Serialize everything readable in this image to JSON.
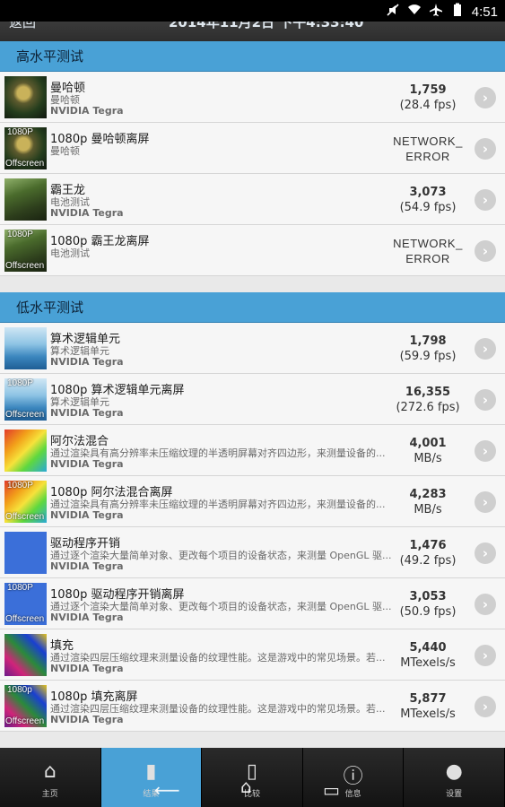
{
  "status_bar": {
    "time": "4:51"
  },
  "header": {
    "back_label": "返回",
    "date": "2014年11月2日 下午4:33:40"
  },
  "sections": [
    {
      "title": "高水平测试",
      "items": [
        {
          "thumb": "manhattan",
          "offscreen": false,
          "title": "曼哈顿",
          "desc": "曼哈顿",
          "vendor": "NVIDIA Tegra",
          "score": "1,759",
          "sub": "(28.4 fps)",
          "error": false
        },
        {
          "thumb": "manhattan",
          "offscreen": true,
          "tag_top": "1080P",
          "tag_bot": "Offscreen",
          "title": "1080p 曼哈顿离屏",
          "desc": "曼哈顿",
          "vendor": "",
          "score": "NETWORK_",
          "sub": "ERROR",
          "error": true
        },
        {
          "thumb": "trex",
          "offscreen": false,
          "title": "霸王龙",
          "desc": "电池测试",
          "vendor": "NVIDIA Tegra",
          "score": "3,073",
          "sub": "(54.9 fps)",
          "error": false
        },
        {
          "thumb": "trex",
          "offscreen": true,
          "tag_top": "1080P",
          "tag_bot": "Offscreen",
          "title": "1080p 霸王龙离屏",
          "desc": "电池测试",
          "vendor": "",
          "score": "NETWORK_",
          "sub": "ERROR",
          "error": true
        }
      ]
    },
    {
      "title": "低水平测试",
      "items": [
        {
          "thumb": "alu",
          "offscreen": false,
          "title": "算术逻辑单元",
          "desc": "算术逻辑单元",
          "vendor": "NVIDIA Tegra",
          "score": "1,798",
          "sub": "(59.9 fps)",
          "error": false
        },
        {
          "thumb": "alu",
          "offscreen": true,
          "tag_top": "1080P",
          "tag_bot": "Offscreen",
          "title": "1080p 算术逻辑单元离屏",
          "desc": "算术逻辑单元",
          "vendor": "NVIDIA Tegra",
          "score": "16,355",
          "sub": "(272.6 fps)",
          "error": false
        },
        {
          "thumb": "alpha",
          "offscreen": false,
          "title": "阿尔法混合",
          "desc": "通过渲染具有高分辨率未压缩纹理的半透明屏幕对齐四边形，来测量设备的...",
          "vendor": "NVIDIA Tegra",
          "score": "4,001",
          "sub": "MB/s",
          "error": false
        },
        {
          "thumb": "alpha",
          "offscreen": true,
          "tag_top": "1080P",
          "tag_bot": "Offscreen",
          "title": "1080p 阿尔法混合离屏",
          "desc": "通过渲染具有高分辨率未压缩纹理的半透明屏幕对齐四边形，来测量设备的...",
          "vendor": "NVIDIA Tegra",
          "score": "4,283",
          "sub": "MB/s",
          "error": false
        },
        {
          "thumb": "driver",
          "offscreen": false,
          "title": "驱动程序开销",
          "desc": "通过逐个渲染大量简单对象、更改每个项目的设备状态，来测量 OpenGL 驱...",
          "vendor": "NVIDIA Tegra",
          "score": "1,476",
          "sub": "(49.2 fps)",
          "error": false
        },
        {
          "thumb": "driver",
          "offscreen": true,
          "tag_top": "1080P",
          "tag_bot": "Offscreen",
          "title": "1080p 驱动程序开销离屏",
          "desc": "通过逐个渲染大量简单对象、更改每个项目的设备状态，来测量 OpenGL 驱...",
          "vendor": "NVIDIA Tegra",
          "score": "3,053",
          "sub": "(50.9 fps)",
          "error": false
        },
        {
          "thumb": "fill",
          "offscreen": false,
          "title": "填充",
          "desc": "通过渲染四层压缩纹理来测量设备的纹理性能。这是游戏中的常见场景。若...",
          "vendor": "NVIDIA Tegra",
          "score": "5,440",
          "sub": "MTexels/s",
          "error": false
        },
        {
          "thumb": "fill",
          "offscreen": true,
          "tag_top": "1080p",
          "tag_bot": "Offscreen",
          "title": "1080p 填充离屏",
          "desc": "通过渲染四层压缩纹理来测量设备的纹理性能。这是游戏中的常见场景。若...",
          "vendor": "NVIDIA Tegra",
          "score": "5,877",
          "sub": "MTexels/s",
          "error": false
        }
      ]
    }
  ],
  "bottom_nav": [
    {
      "label": "主页",
      "icon": "home-icon",
      "glyph": "⌂",
      "active": false
    },
    {
      "label": "结果",
      "icon": "bar-chart-icon",
      "glyph": "▮",
      "active": true
    },
    {
      "label": "比较",
      "icon": "phone-icon",
      "glyph": "▯",
      "active": false
    },
    {
      "label": "信息",
      "icon": "info-icon",
      "glyph": "ⓘ",
      "active": false
    },
    {
      "label": "设置",
      "icon": "user-settings-icon",
      "glyph": "●",
      "active": false
    }
  ],
  "colors": {
    "accent": "#49a1d6",
    "header": "#3a3a3a",
    "row_bg": "#f6f6f6"
  }
}
